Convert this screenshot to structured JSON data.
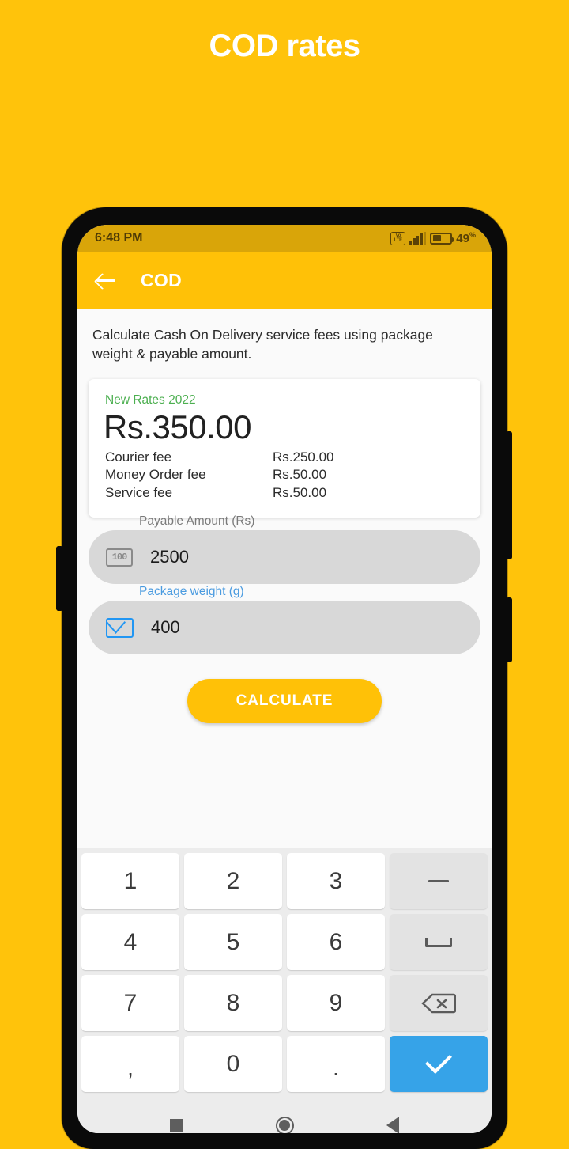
{
  "page": {
    "title": "COD rates",
    "background_color": "#FFC30B"
  },
  "status_bar": {
    "time": "6:48 PM",
    "volte_top": "Vo",
    "volte_bottom": "LTE",
    "battery_percent": "49",
    "percent_symbol": "%"
  },
  "app_bar": {
    "title": "COD",
    "back_icon": "arrow-left-icon"
  },
  "content": {
    "description": "Calculate Cash On Delivery service fees using package weight & payable amount.",
    "result_card": {
      "rates_label": "New Rates 2022",
      "total": "Rs.350.00",
      "fees": [
        {
          "name": "Courier fee",
          "value": "Rs.250.00"
        },
        {
          "name": "Money Order fee",
          "value": "Rs.50.00"
        },
        {
          "name": "Service fee",
          "value": "Rs.50.00"
        }
      ]
    },
    "fields": [
      {
        "label": "Payable Amount (Rs)",
        "value": "2500",
        "icon": "banknote-icon",
        "icon_text": "100",
        "focused": false
      },
      {
        "label": "Package weight (g)",
        "value": "400",
        "icon": "envelope-icon",
        "focused": true
      }
    ],
    "calculate_button": "CALCULATE"
  },
  "keyboard": {
    "rows": [
      [
        {
          "label": "1",
          "type": "num"
        },
        {
          "label": "2",
          "type": "num"
        },
        {
          "label": "3",
          "type": "num"
        },
        {
          "label": "–",
          "type": "fn",
          "icon": "minus-icon"
        }
      ],
      [
        {
          "label": "4",
          "type": "num"
        },
        {
          "label": "5",
          "type": "num"
        },
        {
          "label": "6",
          "type": "num"
        },
        {
          "label": "␣",
          "type": "fn",
          "icon": "space-icon"
        }
      ],
      [
        {
          "label": "7",
          "type": "num"
        },
        {
          "label": "8",
          "type": "num"
        },
        {
          "label": "9",
          "type": "num"
        },
        {
          "label": "",
          "type": "fn",
          "icon": "backspace-icon"
        }
      ],
      [
        {
          "label": ",",
          "type": "punct"
        },
        {
          "label": "0",
          "type": "num"
        },
        {
          "label": ".",
          "type": "punct"
        },
        {
          "label": "",
          "type": "enter",
          "icon": "check-icon"
        }
      ]
    ]
  },
  "nav_bar": {
    "recents": "square-icon",
    "home": "circle-icon",
    "back": "triangle-left-icon"
  }
}
